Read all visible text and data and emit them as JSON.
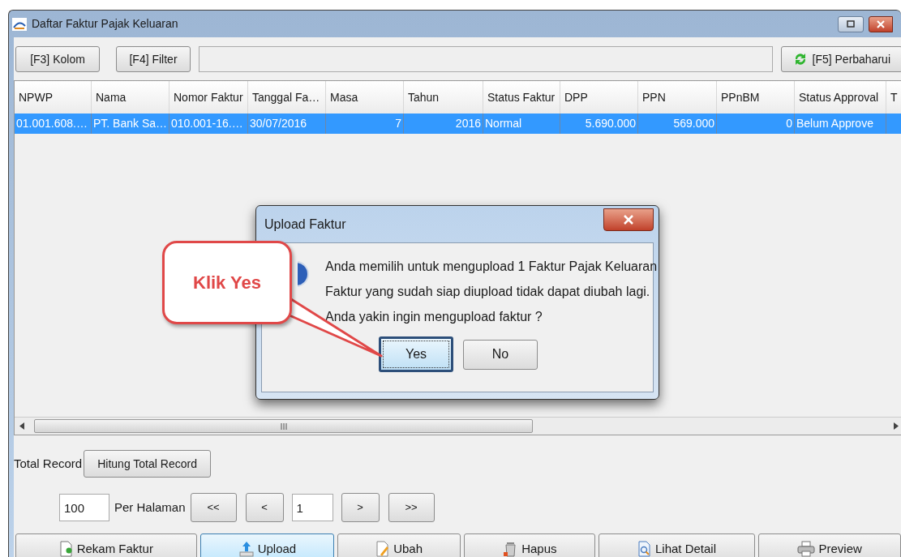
{
  "window": {
    "title": "Daftar Faktur Pajak Keluaran"
  },
  "toolbar": {
    "buttons": [
      {
        "label": "[F3] Kolom"
      },
      {
        "label": "[F4] Filter"
      }
    ],
    "refresh_button": {
      "label": "[F5] Perbaharui"
    }
  },
  "table": {
    "columns": [
      {
        "label": "NPWP",
        "kind": "text"
      },
      {
        "label": "Nama",
        "kind": "text"
      },
      {
        "label": "Nomor Faktur",
        "kind": "text"
      },
      {
        "label": "Tanggal Fa…",
        "kind": "text"
      },
      {
        "label": "Masa",
        "kind": "number"
      },
      {
        "label": "Tahun",
        "kind": "number"
      },
      {
        "label": "Status Faktur",
        "kind": "text"
      },
      {
        "label": "DPP",
        "kind": "number"
      },
      {
        "label": "PPN",
        "kind": "number"
      },
      {
        "label": "PPnBM",
        "kind": "number"
      },
      {
        "label": "Status Approval",
        "kind": "text"
      },
      {
        "label": "T"
      }
    ],
    "rows": [
      {
        "selected": true,
        "cells": [
          "01.001.608.…",
          "PT. Bank Sa…",
          "010.001-16.…",
          "30/07/2016",
          "7",
          "2016",
          "Normal",
          "5.690.000",
          "569.000",
          "0",
          "Belum Approve"
        ]
      }
    ]
  },
  "dialog": {
    "title": "Upload Faktur",
    "lines": [
      "Anda memilih untuk mengupload 1 Faktur Pajak Keluaran",
      "Faktur yang sudah siap diupload tidak dapat diubah lagi.",
      "Anda yakin ingin mengupload faktur ?"
    ],
    "buttons": [
      {
        "label": "Yes",
        "focused": true
      },
      {
        "label": "No",
        "focused": false
      }
    ]
  },
  "callout": {
    "text": "Klik Yes"
  },
  "total_record": {
    "label": "Total Record",
    "button": "Hitung Total Record"
  },
  "pagination": {
    "page_size": "100",
    "page_size_label": "Per Halaman",
    "first": "<<",
    "prev": "<",
    "page": "1",
    "next": ">",
    "last": ">>"
  },
  "actions": [
    {
      "label": "Rekam Faktur",
      "kind": "new",
      "highlighted": false
    },
    {
      "label": "Upload",
      "kind": "upload",
      "highlighted": true
    },
    {
      "label": "Ubah",
      "kind": "edit",
      "highlighted": false
    },
    {
      "label": "Hapus",
      "kind": "delete",
      "highlighted": false
    },
    {
      "label": "Lihat Detail",
      "kind": "detail",
      "highlighted": false
    },
    {
      "label": "Preview",
      "kind": "print",
      "highlighted": false
    }
  ]
}
